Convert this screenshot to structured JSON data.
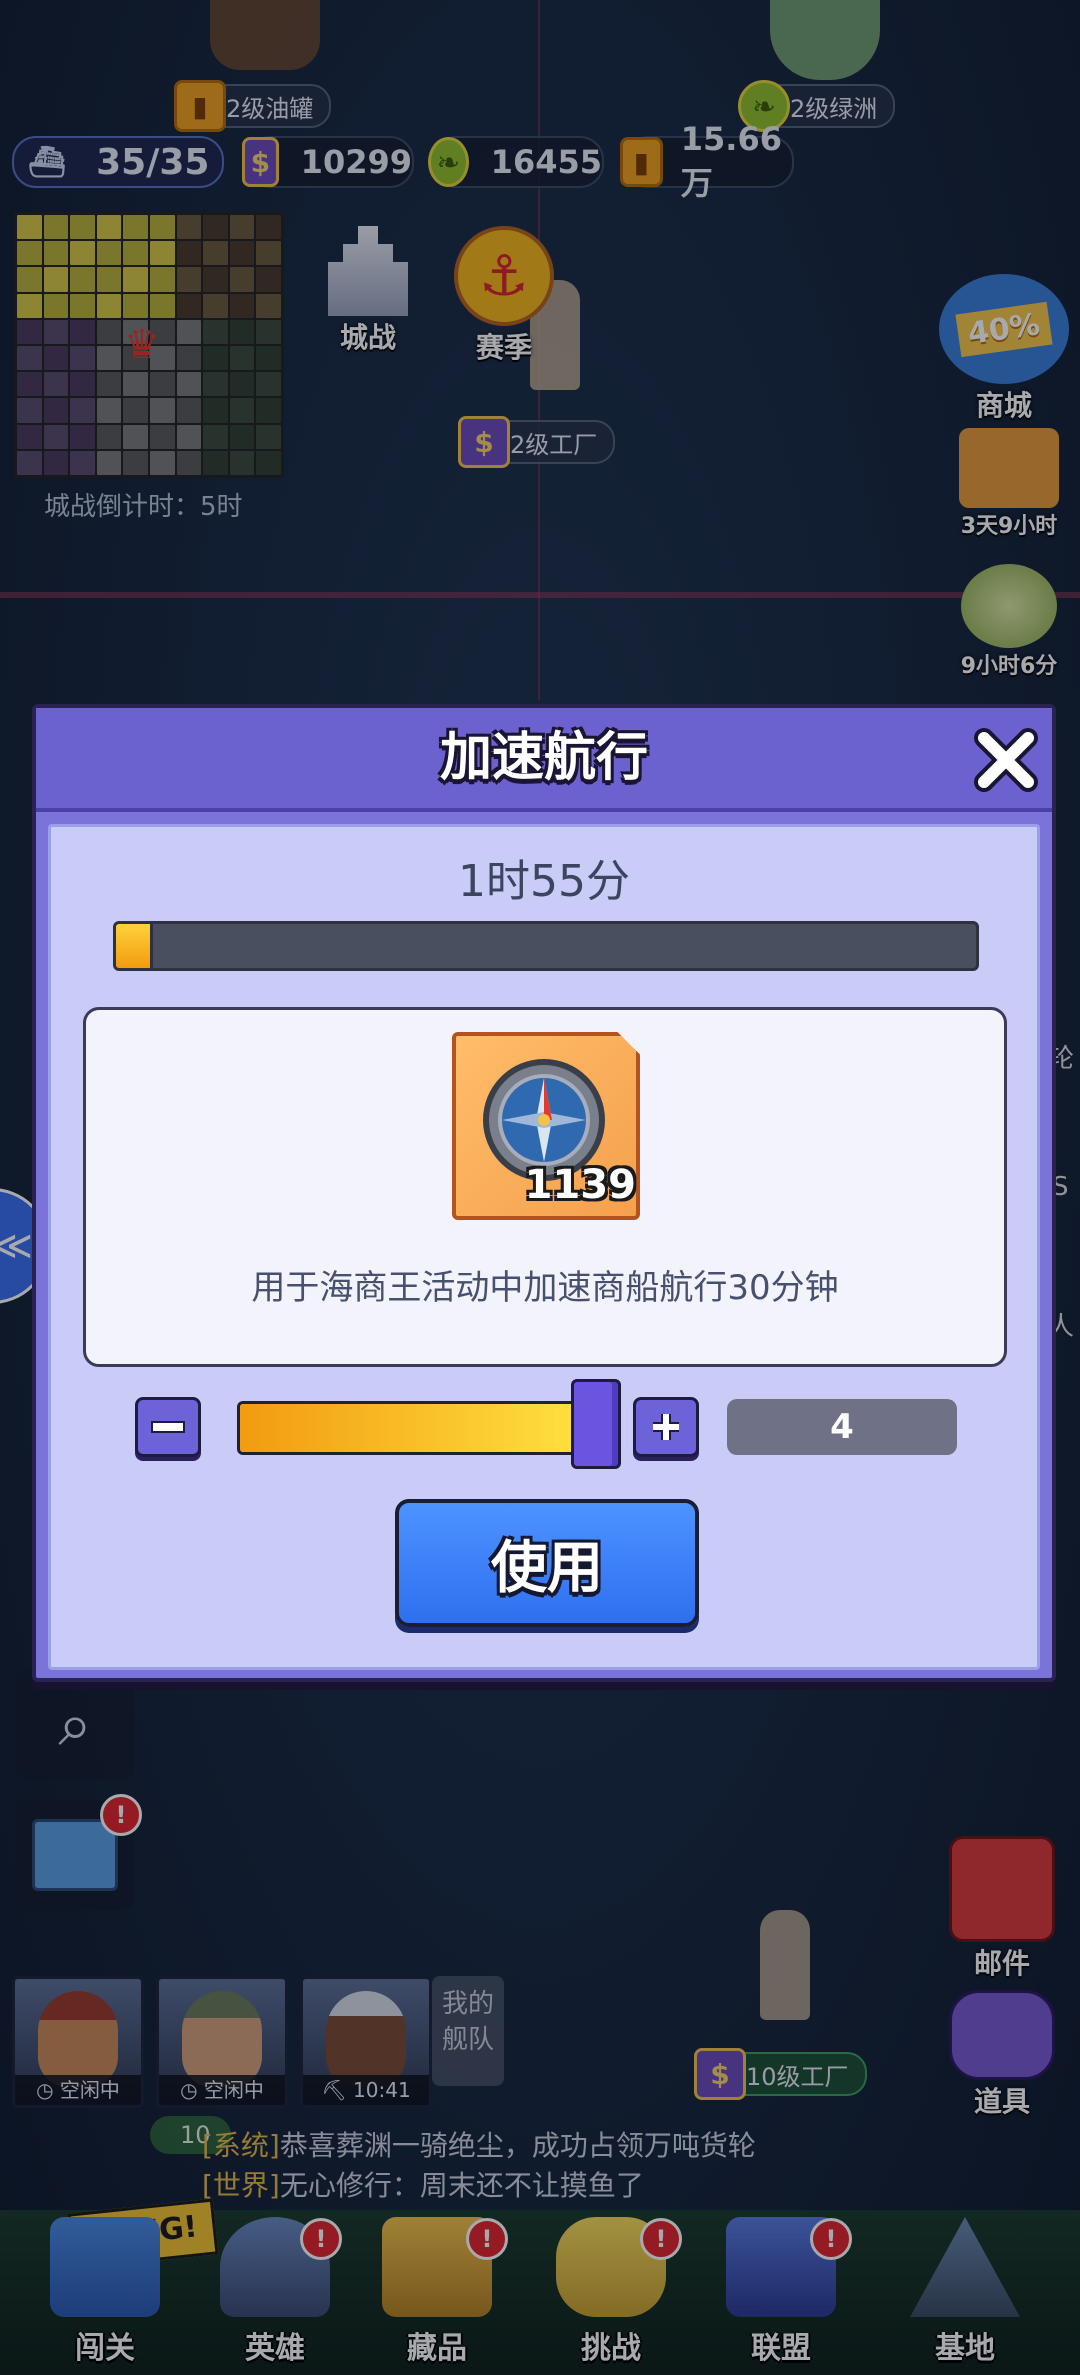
{
  "hud": {
    "ship_count": "35/35",
    "coins": "10299",
    "leaves": "16455",
    "oil": "15.66万"
  },
  "map_labels": {
    "oil_tank": "2级油罐",
    "oasis": "2级绿洲",
    "factory_2": "2级工厂",
    "factory_10": "10级工厂",
    "partial_label": "10"
  },
  "minimap": {
    "countdown": "城战倒计时：5时"
  },
  "side_buttons": {
    "city_war": "城战",
    "season": "赛季",
    "shop": "商城",
    "shop_discount": "40%",
    "event1_timer": "3天9小时",
    "event2_timer": "9小时6分",
    "mail": "邮件",
    "items": "道具",
    "edge_text_1": "轮",
    "edge_text_2": "S",
    "edge_text_3": "人"
  },
  "dialog": {
    "title": "加速航行",
    "timer": "1时55分",
    "progress_fraction": 0.04,
    "item_count": "1139",
    "item_description": "用于海商王活动中加速商船航行30分钟",
    "quantity": "4",
    "slider_fraction": 1.0,
    "use_label": "使用"
  },
  "fleet": {
    "title": "我的舰队",
    "heroes": [
      {
        "status": "空闲中"
      },
      {
        "status": "空闲中"
      },
      {
        "status": "10:41"
      }
    ]
  },
  "chat": [
    {
      "tag": "[系统]",
      "msg": "恭喜葬渊一骑绝尘，成功占领万吨货轮"
    },
    {
      "tag": "[世界]",
      "msg": "无心修行：周末还不让摸鱼了"
    }
  ],
  "bottom_nav": [
    {
      "label": "闯关",
      "badge": ""
    },
    {
      "label": "英雄",
      "badge": "!"
    },
    {
      "label": "藏品",
      "badge": "!"
    },
    {
      "label": "挑战",
      "badge": "!"
    },
    {
      "label": "联盟",
      "badge": "!"
    },
    {
      "label": "基地",
      "badge": ""
    }
  ],
  "bang_text": "BANG!",
  "colors": {
    "dialog_frame": "#7c73d8",
    "dialog_body": "#c9ccf7",
    "use_button": "#2f6ff0",
    "progress": "#f29b10"
  }
}
